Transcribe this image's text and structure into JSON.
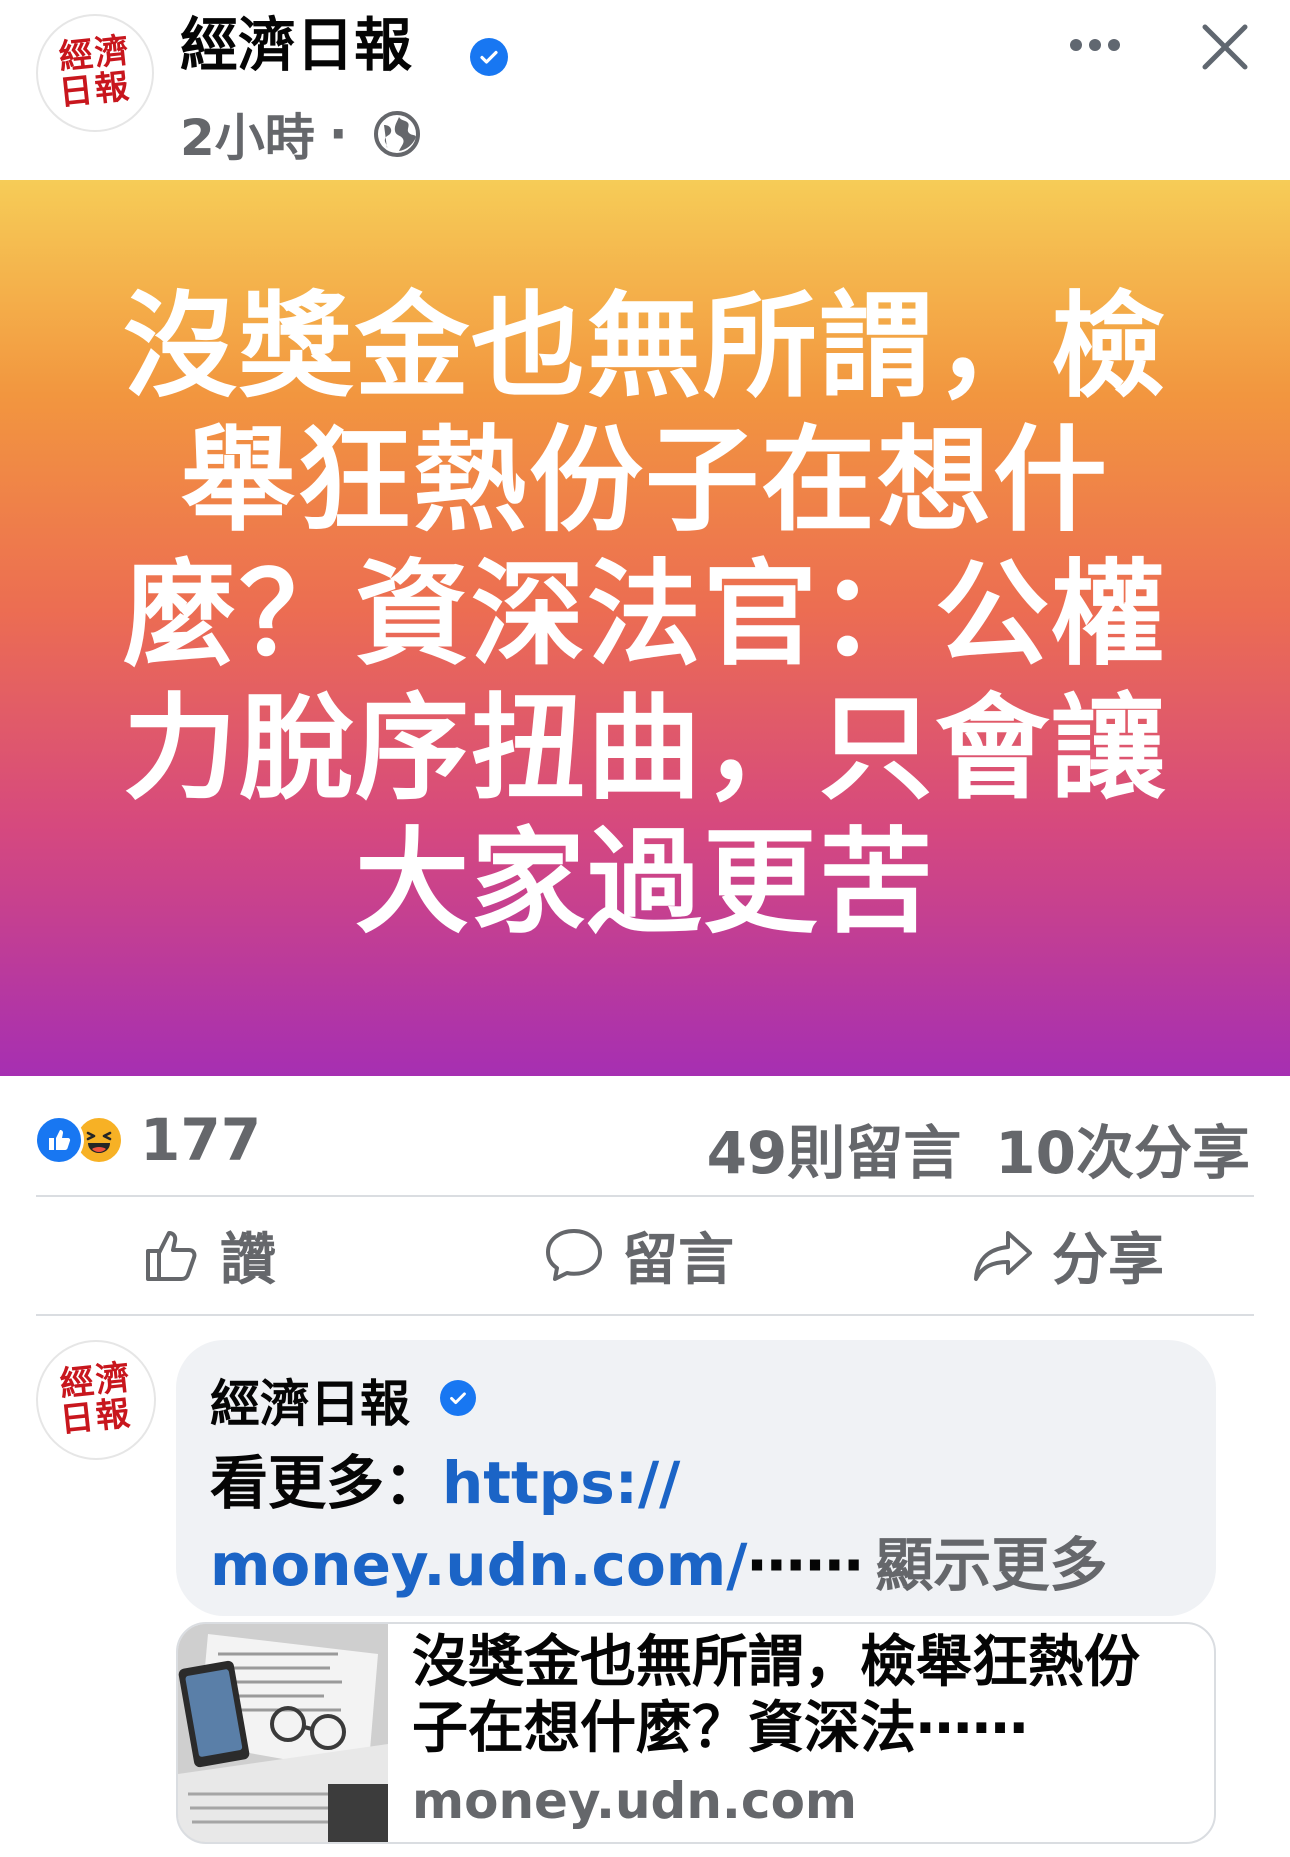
{
  "header": {
    "page_name": "經濟日報",
    "avatar_text_line1": "經濟",
    "avatar_text_line2": "日報",
    "time": "2小時",
    "separator": "·"
  },
  "banner": {
    "text": "沒獎金也無所謂，檢舉狂熱份子在想什麼？資深法官：公權力脫序扭曲，只會讓大家過更苦"
  },
  "stats": {
    "reaction_count": "177",
    "comments": "49則留言",
    "shares": "10次分享"
  },
  "actions": {
    "like_label": "讚",
    "comment_label": "留言",
    "share_label": "分享"
  },
  "comment": {
    "author": "經濟日報",
    "line1_prefix": "看更多：",
    "line1_link": "https://",
    "line2_link": "money.udn.com/",
    "ellipsis": "⋯⋯",
    "see_more": "顯示更多"
  },
  "link_preview": {
    "title": "沒獎金也無所謂，檢舉狂熱份子在想什麼？資深法⋯⋯",
    "domain": "money.udn.com"
  },
  "colors": {
    "brand_red": "#c8161d",
    "facebook_blue": "#1877f2",
    "link_blue": "#1b64c6",
    "secondary_text": "#65676b",
    "gradient_top": "#f6cc57",
    "gradient_bottom": "#a62fb2"
  },
  "icons": {
    "verified": "verified-badge-icon",
    "globe": "globe-icon",
    "more": "more-dots-icon",
    "close": "close-icon",
    "like_reaction": "like-reaction-icon",
    "haha_reaction": "haha-reaction-icon",
    "thumbs_up": "thumbs-up-icon",
    "comment": "comment-bubble-icon",
    "share": "share-arrow-icon"
  }
}
